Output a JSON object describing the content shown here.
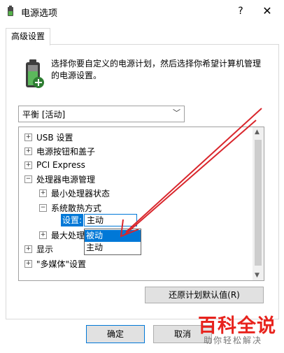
{
  "window": {
    "title": "电源选项",
    "help": "?",
    "close": "✕"
  },
  "tab": {
    "label": "高级设置"
  },
  "description": "选择你要自定义的电源计划，然后选择你希望计算机管理的电源设置。",
  "plan_select": {
    "value": "平衡 [活动]"
  },
  "tree": {
    "items": [
      {
        "expander": "+",
        "label": "USB 设置"
      },
      {
        "expander": "+",
        "label": "电源按钮和盖子"
      },
      {
        "expander": "+",
        "label": "PCI Express"
      },
      {
        "expander": "−",
        "label": "处理器电源管理"
      },
      {
        "expander": "+",
        "label": "最小处理器状态"
      },
      {
        "expander": "−",
        "label": "系统散热方式"
      },
      {
        "expander": "+",
        "label": "最大处理"
      },
      {
        "expander": "+",
        "label": "显示"
      },
      {
        "expander": "+",
        "label": "\"多媒体\"设置"
      }
    ],
    "setting": {
      "label": "设置:",
      "current": "主动",
      "options": [
        "被动",
        "主动"
      ],
      "highlighted": "被动"
    }
  },
  "restore_button": "还原计划默认值(R)",
  "ok_button": "确定",
  "cancel_button": "取消",
  "watermark": {
    "main": "百科全说",
    "sub": "助你轻松解决"
  },
  "colors": {
    "accent": "#0078d7",
    "annotation_arrow": "#d9262c"
  }
}
